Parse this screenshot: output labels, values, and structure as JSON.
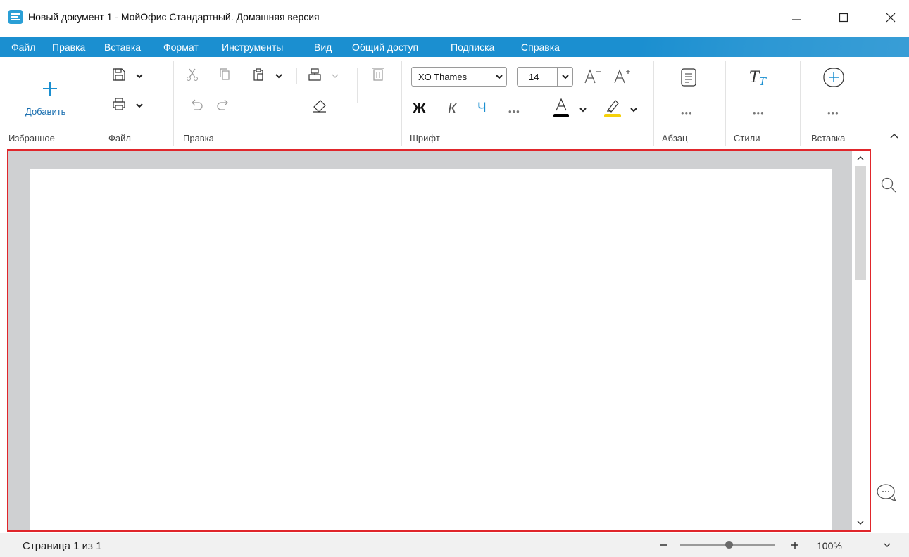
{
  "window": {
    "title": "Новый документ 1 - МойОфис Стандартный. Домашняя версия"
  },
  "menu": {
    "items": [
      "Файл",
      "Правка",
      "Вставка",
      "Формат",
      "Инструменты",
      "Вид",
      "Общий доступ",
      "Подписка",
      "Справка"
    ]
  },
  "ribbon": {
    "favorites": {
      "add_label": "Добавить",
      "group_label": "Избранное"
    },
    "file": {
      "group_label": "Файл"
    },
    "edit": {
      "group_label": "Правка"
    },
    "font": {
      "family": "XO Thames",
      "size": "14",
      "group_label": "Шрифт",
      "bold": "Ж",
      "italic": "К",
      "underline": "Ч",
      "font_color": "#000000",
      "highlight_color": "#f5d10a"
    },
    "paragraph": {
      "group_label": "Абзац"
    },
    "styles": {
      "group_label": "Стили"
    },
    "insert": {
      "group_label": "Вставка"
    },
    "more_label": "•••"
  },
  "icons": {
    "toolbar": [
      "plus-icon",
      "save-icon",
      "print-icon",
      "cut-icon",
      "copy-icon",
      "paste-icon",
      "format-painter-icon",
      "delete-icon",
      "undo-icon",
      "redo-icon",
      "eraser-icon",
      "decrease-font-icon",
      "increase-font-icon",
      "font-color-icon",
      "highlight-icon",
      "paragraph-icon",
      "styles-icon",
      "insert-plus-icon",
      "collapse-ribbon-icon"
    ],
    "sidepanel": [
      "search-icon",
      "comments-icon"
    ]
  },
  "status": {
    "page_info": "Страница 1 из 1",
    "zoom_percent": 100,
    "zoom_label": "100%"
  },
  "colors": {
    "menu_bar": "#1b8fd0",
    "accent": "#2a9fd6",
    "highlight_frame": "#e0262b"
  }
}
